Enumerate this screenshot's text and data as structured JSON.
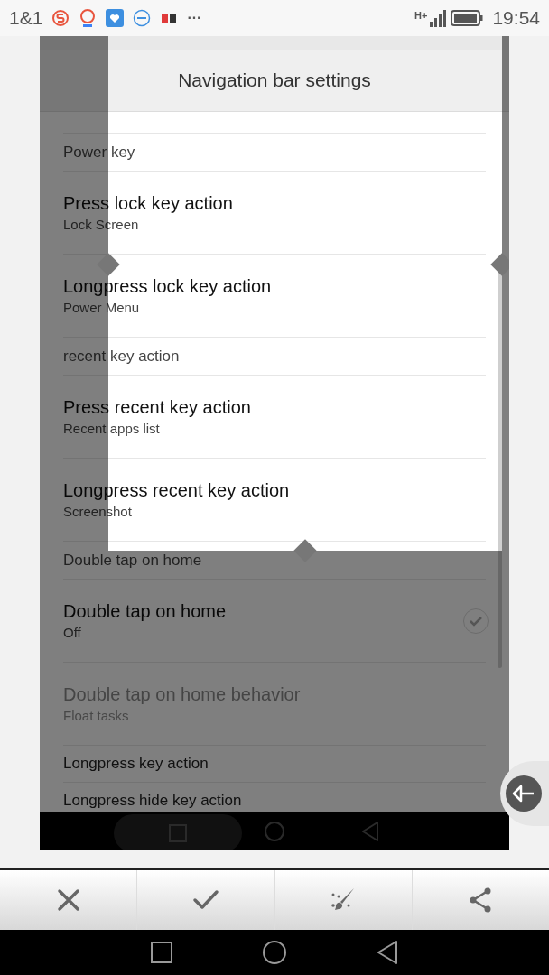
{
  "status_bar": {
    "carrier": "1&1",
    "more": "···",
    "network_type": "H+",
    "time": "19:54"
  },
  "screenshot": {
    "header_title": "Navigation bar settings",
    "rows": [
      {
        "kind": "category",
        "title": "Power key"
      },
      {
        "kind": "setting",
        "title": "Press lock key action",
        "summary": "Lock Screen",
        "disabled": false
      },
      {
        "kind": "setting",
        "title": "Longpress lock key action",
        "summary": "Power Menu",
        "disabled": false
      },
      {
        "kind": "category",
        "title": "recent key action"
      },
      {
        "kind": "setting",
        "title": "Press recent key action",
        "summary": "Recent apps list",
        "disabled": false
      },
      {
        "kind": "setting",
        "title": "Longpress recent key action",
        "summary": "Screenshot",
        "disabled": false
      },
      {
        "kind": "category",
        "title": "Double tap on home"
      },
      {
        "kind": "setting",
        "title": "Double tap on home",
        "summary": "Off",
        "disabled": false,
        "checked": false
      },
      {
        "kind": "setting",
        "title": "Double tap on home behavior",
        "summary": "Float tasks",
        "disabled": true
      },
      {
        "kind": "setting",
        "title": "Longpress key action",
        "disabled": false
      },
      {
        "kind": "setting",
        "title": "Longpress hide key action",
        "disabled": false
      }
    ]
  },
  "toolbar": {
    "buttons": [
      {
        "kind": "discard"
      },
      {
        "kind": "confirm"
      },
      {
        "kind": "paint"
      },
      {
        "kind": "share"
      }
    ]
  }
}
